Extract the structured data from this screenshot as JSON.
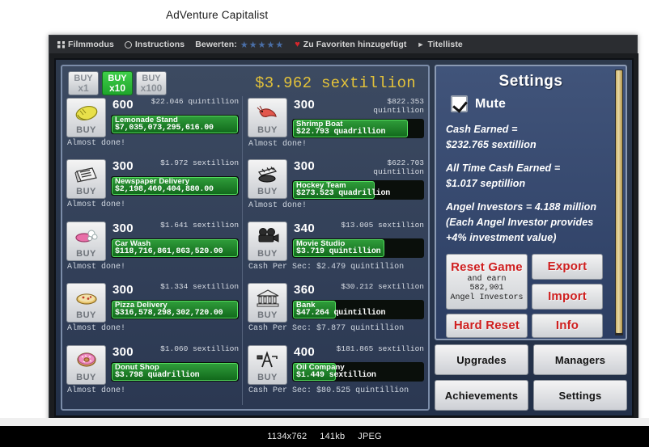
{
  "page": {
    "title": "AdVenture Capitalist"
  },
  "flash_toolbar": {
    "items": [
      {
        "icon": "film-mode-icon",
        "label": "Filmmodus"
      },
      {
        "icon": "instructions-icon",
        "label": "Instructions"
      },
      {
        "icon": "rating-icon",
        "label": "Bewerten:",
        "stars": "★★★★★"
      },
      {
        "icon": "heart-icon",
        "label": "Zu Favoriten hinzugefügt"
      },
      {
        "icon": "play-icon",
        "label": "Titelliste"
      }
    ]
  },
  "game": {
    "total_cash": "$3.962 sextillion",
    "buy_multipliers": [
      {
        "name": "buy-x1",
        "line1": "BUY",
        "line2": "x1",
        "active": false
      },
      {
        "name": "buy-x10",
        "line1": "BUY",
        "line2": "x10",
        "active": true
      },
      {
        "name": "buy-x100",
        "line1": "BUY",
        "line2": "x100",
        "active": false
      }
    ],
    "buy_label": "BUY",
    "businesses_left": [
      {
        "name": "Lemonade Stand",
        "icon": "lemon-icon",
        "count": "600",
        "cost": "$22.046 quintillion",
        "revenue": "$7,035,073,295,616.00",
        "status": "Almost done!",
        "progress_pct": 100
      },
      {
        "name": "Newspaper Delivery",
        "icon": "newspaper-icon",
        "count": "300",
        "cost": "$1.972 sextillion",
        "revenue": "$2,198,460,404,880.00",
        "status": "Almost done!",
        "progress_pct": 100
      },
      {
        "name": "Car Wash",
        "icon": "car-wash-icon",
        "count": "300",
        "cost": "$1.641 sextillion",
        "revenue": "$118,716,861,863,520.00",
        "status": "Almost done!",
        "progress_pct": 100
      },
      {
        "name": "Pizza Delivery",
        "icon": "pizza-icon",
        "count": "300",
        "cost": "$1.334 sextillion",
        "revenue": "$316,578,298,302,720.00",
        "status": "Almost done!",
        "progress_pct": 100
      },
      {
        "name": "Donut Shop",
        "icon": "donut-icon",
        "count": "300",
        "cost": "$1.060 sextillion",
        "revenue": "$3.798 quadrillion",
        "status": "Almost done!",
        "progress_pct": 100
      }
    ],
    "businesses_right": [
      {
        "name": "Shrimp Boat",
        "icon": "shrimp-icon",
        "count": "300",
        "cost": "$822.353 quintillion",
        "revenue": "$22.793 quadrillion",
        "status": "Almost done!",
        "progress_pct": 88
      },
      {
        "name": "Hockey Team",
        "icon": "hockey-icon",
        "count": "300",
        "cost": "$622.703 quintillion",
        "revenue": "$273.523 quadrillion",
        "status": "Almost done!",
        "progress_pct": 63
      },
      {
        "name": "Movie Studio",
        "icon": "movie-camera-icon",
        "count": "340",
        "cost": "$13.005 sextillion",
        "revenue": "$3.719 quintillion",
        "status": "Cash Per Sec: $2.479 quintillion",
        "progress_pct": 70
      },
      {
        "name": "Bank",
        "icon": "bank-icon",
        "count": "360",
        "cost": "$30.212 sextillion",
        "revenue": "$47.264 quintillion",
        "status": "Cash Per Sec: $7.877 quintillion",
        "progress_pct": 33
      },
      {
        "name": "Oil Company",
        "icon": "oil-rig-icon",
        "count": "400",
        "cost": "$181.865 sextillion",
        "revenue": "$1.449 sextillion",
        "status": "Cash Per Sec: $80.525 quintillion",
        "progress_pct": 33
      }
    ],
    "settings": {
      "title": "Settings",
      "mute_label": "Mute",
      "mute_checked": true,
      "stats": [
        {
          "label": "Cash Earned =",
          "value": "$232.765 sextillion"
        },
        {
          "label": "All Time Cash Earned =",
          "value": "$1.017 septillion"
        }
      ],
      "angel_lines": [
        "Angel Investors = 4.188 million",
        "(Each Angel Investor provides",
        "+4% investment value)"
      ],
      "buttons": {
        "reset_game": "Reset Game",
        "reset_game_sub_line1": "and earn 582,901",
        "reset_game_sub_line2": "Angel Investors",
        "export": "Export",
        "import": "Import",
        "hard_reset": "Hard Reset",
        "info": "Info"
      },
      "accent_red": "#cf2020",
      "accent_green": "#2f9c3a",
      "accent_gold": "#e3c23a"
    },
    "nav_buttons": [
      "Upgrades",
      "Managers",
      "Achievements",
      "Settings"
    ]
  },
  "meta": {
    "dimensions": "1134x762",
    "filesize": "141kb",
    "format": "JPEG"
  }
}
